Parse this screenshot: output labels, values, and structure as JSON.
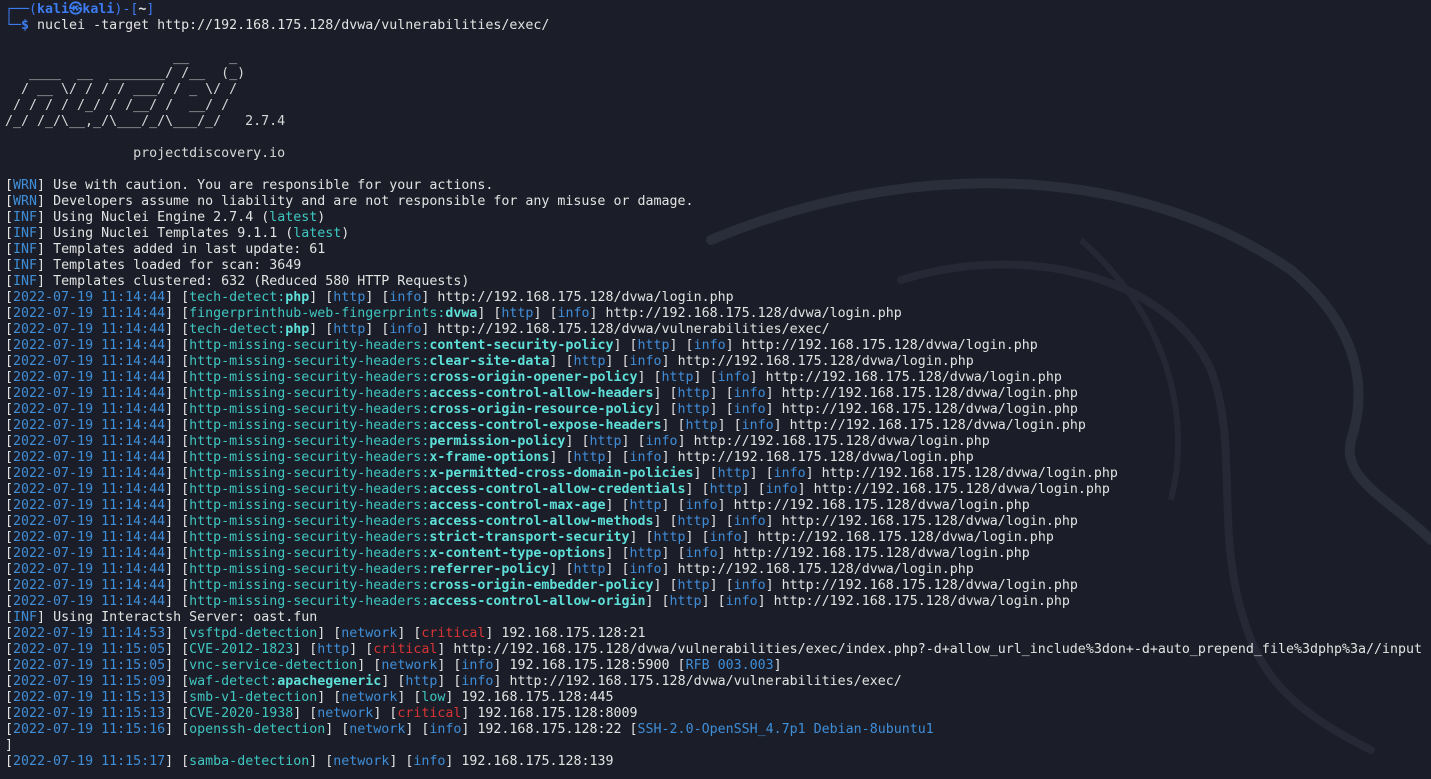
{
  "prompt": {
    "line1_prefix": "┌──(",
    "user_host": "kali㉿kali",
    "line1_mid": ")-[",
    "cwd": "~",
    "line1_suffix": "]",
    "line2_prefix": "└─",
    "dollar": "$",
    "command": " nuclei -target http://192.168.175.128/dvwa/vulnerabilities/exec/"
  },
  "banner": {
    "art": [
      "",
      "                     __     _",
      "   ____  __  _______/ /__  (_)",
      "  / __ \\/ / / / ___/ / _ \\/ /",
      " / / / / /_/ / /__/ /  __/ /",
      "/_/ /_/\\__,_/\\___/_/\\___/_/   2.7.4",
      "",
      "\t\tprojectdiscovery.io",
      ""
    ]
  },
  "messages": [
    {
      "tag": "WRN",
      "text": " Use with caution. You are responsible for your actions."
    },
    {
      "tag": "WRN",
      "text": " Developers assume no liability and are not responsible for any misuse or damage."
    },
    {
      "tag": "INF",
      "text": " Using Nuclei Engine 2.7.4 (",
      "hl": "latest",
      "tail": ")"
    },
    {
      "tag": "INF",
      "text": " Using Nuclei Templates 9.1.1 (",
      "hl": "latest",
      "tail": ")"
    },
    {
      "tag": "INF",
      "text": " Templates added in last update: 61"
    },
    {
      "tag": "INF",
      "text": " Templates loaded for scan: 3649"
    },
    {
      "tag": "INF",
      "text": " Templates clustered: 632 (Reduced 580 HTTP Requests)"
    }
  ],
  "results1": [
    {
      "ts": "2022-07-19 11:14:44",
      "tpl": "tech-detect",
      "match": "php",
      "proto": "http",
      "sev": "info",
      "url": "http://192.168.175.128/dvwa/login.php"
    },
    {
      "ts": "2022-07-19 11:14:44",
      "tpl": "fingerprinthub-web-fingerprints",
      "match": "dvwa",
      "proto": "http",
      "sev": "info",
      "url": "http://192.168.175.128/dvwa/login.php"
    },
    {
      "ts": "2022-07-19 11:14:44",
      "tpl": "tech-detect",
      "match": "php",
      "proto": "http",
      "sev": "info",
      "url": "http://192.168.175.128/dvwa/vulnerabilities/exec/"
    },
    {
      "ts": "2022-07-19 11:14:44",
      "tpl": "http-missing-security-headers",
      "match": "content-security-policy",
      "proto": "http",
      "sev": "info",
      "url": "http://192.168.175.128/dvwa/login.php"
    },
    {
      "ts": "2022-07-19 11:14:44",
      "tpl": "http-missing-security-headers",
      "match": "clear-site-data",
      "proto": "http",
      "sev": "info",
      "url": "http://192.168.175.128/dvwa/login.php"
    },
    {
      "ts": "2022-07-19 11:14:44",
      "tpl": "http-missing-security-headers",
      "match": "cross-origin-opener-policy",
      "proto": "http",
      "sev": "info",
      "url": "http://192.168.175.128/dvwa/login.php"
    },
    {
      "ts": "2022-07-19 11:14:44",
      "tpl": "http-missing-security-headers",
      "match": "access-control-allow-headers",
      "proto": "http",
      "sev": "info",
      "url": "http://192.168.175.128/dvwa/login.php"
    },
    {
      "ts": "2022-07-19 11:14:44",
      "tpl": "http-missing-security-headers",
      "match": "cross-origin-resource-policy",
      "proto": "http",
      "sev": "info",
      "url": "http://192.168.175.128/dvwa/login.php"
    },
    {
      "ts": "2022-07-19 11:14:44",
      "tpl": "http-missing-security-headers",
      "match": "access-control-expose-headers",
      "proto": "http",
      "sev": "info",
      "url": "http://192.168.175.128/dvwa/login.php"
    },
    {
      "ts": "2022-07-19 11:14:44",
      "tpl": "http-missing-security-headers",
      "match": "permission-policy",
      "proto": "http",
      "sev": "info",
      "url": "http://192.168.175.128/dvwa/login.php"
    },
    {
      "ts": "2022-07-19 11:14:44",
      "tpl": "http-missing-security-headers",
      "match": "x-frame-options",
      "proto": "http",
      "sev": "info",
      "url": "http://192.168.175.128/dvwa/login.php"
    },
    {
      "ts": "2022-07-19 11:14:44",
      "tpl": "http-missing-security-headers",
      "match": "x-permitted-cross-domain-policies",
      "proto": "http",
      "sev": "info",
      "url": "http://192.168.175.128/dvwa/login.php"
    },
    {
      "ts": "2022-07-19 11:14:44",
      "tpl": "http-missing-security-headers",
      "match": "access-control-allow-credentials",
      "proto": "http",
      "sev": "info",
      "url": "http://192.168.175.128/dvwa/login.php"
    },
    {
      "ts": "2022-07-19 11:14:44",
      "tpl": "http-missing-security-headers",
      "match": "access-control-max-age",
      "proto": "http",
      "sev": "info",
      "url": "http://192.168.175.128/dvwa/login.php"
    },
    {
      "ts": "2022-07-19 11:14:44",
      "tpl": "http-missing-security-headers",
      "match": "access-control-allow-methods",
      "proto": "http",
      "sev": "info",
      "url": "http://192.168.175.128/dvwa/login.php"
    },
    {
      "ts": "2022-07-19 11:14:44",
      "tpl": "http-missing-security-headers",
      "match": "strict-transport-security",
      "proto": "http",
      "sev": "info",
      "url": "http://192.168.175.128/dvwa/login.php"
    },
    {
      "ts": "2022-07-19 11:14:44",
      "tpl": "http-missing-security-headers",
      "match": "x-content-type-options",
      "proto": "http",
      "sev": "info",
      "url": "http://192.168.175.128/dvwa/login.php"
    },
    {
      "ts": "2022-07-19 11:14:44",
      "tpl": "http-missing-security-headers",
      "match": "referrer-policy",
      "proto": "http",
      "sev": "info",
      "url": "http://192.168.175.128/dvwa/login.php"
    },
    {
      "ts": "2022-07-19 11:14:44",
      "tpl": "http-missing-security-headers",
      "match": "cross-origin-embedder-policy",
      "proto": "http",
      "sev": "info",
      "url": "http://192.168.175.128/dvwa/login.php"
    },
    {
      "ts": "2022-07-19 11:14:44",
      "tpl": "http-missing-security-headers",
      "match": "access-control-allow-origin",
      "proto": "http",
      "sev": "info",
      "url": "http://192.168.175.128/dvwa/login.php"
    }
  ],
  "interactsh": {
    "tag": "INF",
    "text": " Using Interactsh Server: oast.fun"
  },
  "results2": [
    {
      "ts": "2022-07-19 11:14:53",
      "tpl": "vsftpd-detection",
      "match": "",
      "proto": "network",
      "sev": "critical",
      "url": "192.168.175.128:21"
    },
    {
      "ts": "2022-07-19 11:15:05",
      "tpl": "CVE-2012-1823",
      "match": "",
      "proto": "http",
      "sev": "critical",
      "url": "http://192.168.175.128/dvwa/vulnerabilities/exec/index.php?-d+allow_url_include%3don+-d+auto_prepend_file%3dphp%3a//input"
    },
    {
      "ts": "2022-07-19 11:15:05",
      "tpl": "vnc-service-detection",
      "match": "",
      "proto": "network",
      "sev": "info",
      "url": "192.168.175.128:5900",
      "extra": "RFB 003.003"
    },
    {
      "ts": "2022-07-19 11:15:09",
      "tpl": "waf-detect",
      "match": "apachegeneric",
      "proto": "http",
      "sev": "info",
      "url": "http://192.168.175.128/dvwa/vulnerabilities/exec/"
    },
    {
      "ts": "2022-07-19 11:15:13",
      "tpl": "smb-v1-detection",
      "match": "",
      "proto": "network",
      "sev": "low",
      "url": "192.168.175.128:445"
    },
    {
      "ts": "2022-07-19 11:15:13",
      "tpl": "CVE-2020-1938",
      "match": "",
      "proto": "network",
      "sev": "critical",
      "url": "192.168.175.128:8009"
    },
    {
      "ts": "2022-07-19 11:15:16",
      "tpl": "openssh-detection",
      "match": "",
      "proto": "network",
      "sev": "info",
      "url": "192.168.175.128:22",
      "extra": "SSH-2.0-OpenSSH_4.7p1 Debian-8ubuntu1"
    }
  ],
  "stray_bracket": "]",
  "results3": [
    {
      "ts": "2022-07-19 11:15:17",
      "tpl": "samba-detection",
      "match": "",
      "proto": "network",
      "sev": "info",
      "url": "192.168.175.128:139"
    }
  ],
  "colors": {
    "background": "#1b1d28",
    "timestamp": "#3f8ed8",
    "template": "#3fc7c1",
    "matcher": "#5ee0d9",
    "critical": "#d83434",
    "info": "#3f8ed8",
    "text": "#e3e3e3"
  }
}
